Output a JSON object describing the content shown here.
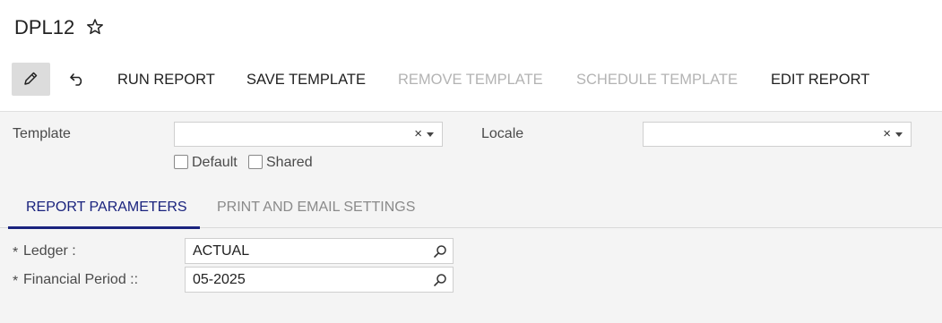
{
  "page": {
    "title": "DPL12"
  },
  "toolbar": {
    "run_report": "RUN REPORT",
    "save_template": "SAVE TEMPLATE",
    "remove_template": "REMOVE TEMPLATE",
    "schedule_template": "SCHEDULE TEMPLATE",
    "edit_report": "EDIT REPORT",
    "icons": {
      "edit": "pencil-icon",
      "undo": "undo-icon",
      "favorite": "star-icon"
    }
  },
  "form": {
    "template_label": "Template",
    "template_value": "",
    "locale_label": "Locale",
    "locale_value": "",
    "clear_glyph": "×",
    "default_label": "Default",
    "shared_label": "Shared",
    "default_checked": false,
    "shared_checked": false
  },
  "tabs": [
    {
      "label": "REPORT PARAMETERS",
      "active": true
    },
    {
      "label": "PRINT AND EMAIL SETTINGS",
      "active": false
    }
  ],
  "parameters": {
    "required_mark": "*",
    "ledger_label": "Ledger :",
    "ledger_value": "ACTUAL",
    "period_label": "Financial Period ::",
    "period_value": "05-2025"
  },
  "colors": {
    "active_tab": "#1a237e",
    "disabled_text": "#b3b3b3",
    "form_background": "#f4f4f4"
  }
}
